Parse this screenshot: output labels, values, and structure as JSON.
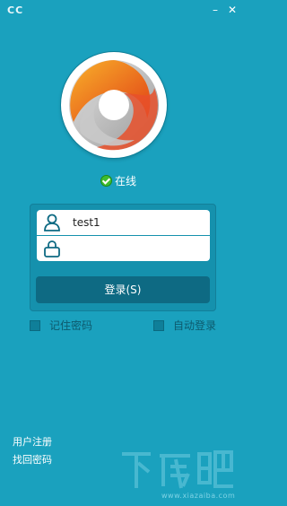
{
  "window": {
    "title": "CC",
    "minimize_glyph": "–",
    "close_glyph": "✕"
  },
  "logo": {
    "icon": "swirl-logo",
    "colors": [
      "#e84b1e",
      "#f6a31a",
      "#b9b9b9"
    ]
  },
  "status": {
    "text": "在线",
    "color": "#3fbd2f"
  },
  "login": {
    "username_value": "test1",
    "password_value": "",
    "username_icon": "user-icon",
    "password_icon": "lock-icon",
    "button_label": "登录(S)"
  },
  "options": {
    "remember_password": {
      "label": "记住密码",
      "checked": false
    },
    "auto_login": {
      "label": "自动登录",
      "checked": false
    }
  },
  "links": {
    "register": "用户注册",
    "recover_password": "找回密码"
  },
  "watermark": {
    "text": "下载吧",
    "url": "www.xiazaiba.com"
  },
  "theme": {
    "background": "#1aa1be",
    "panel": "#1591ad",
    "button": "#0e6a83"
  }
}
